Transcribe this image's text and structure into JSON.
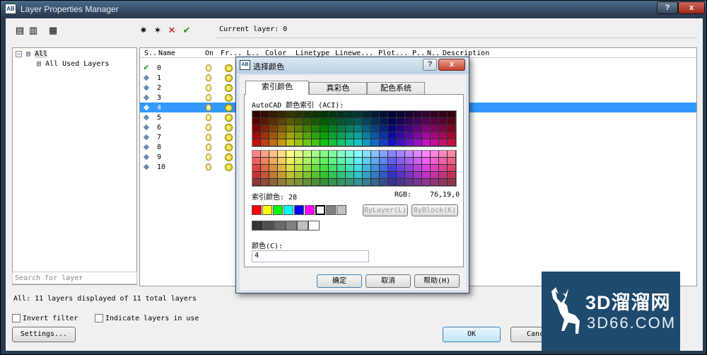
{
  "window": {
    "title": "Layer Properties Manager",
    "app_icon": "AB",
    "help": "?",
    "close": "x"
  },
  "toolbar": {
    "current_layer": "Current layer: 0"
  },
  "tree": {
    "root": "All",
    "child": "All Used Layers"
  },
  "search": {
    "placeholder": "Search for layer"
  },
  "grid": {
    "columns": [
      "S..",
      "Name",
      "On",
      "Fr...",
      "L..",
      "Color",
      "Linetype",
      "Linewe...",
      "Plot...",
      "P..",
      "N..",
      "Description"
    ],
    "rows": [
      {
        "name": "0",
        "current": true
      },
      {
        "name": "1"
      },
      {
        "name": "2"
      },
      {
        "name": "3"
      },
      {
        "name": "4",
        "selected": true
      },
      {
        "name": "5"
      },
      {
        "name": "6"
      },
      {
        "name": "7"
      },
      {
        "name": "8"
      },
      {
        "name": "9"
      },
      {
        "name": "10"
      }
    ]
  },
  "status": "All: 11 layers displayed of 11 total layers",
  "options": {
    "invert_filter": "Invert filter",
    "indicate_layers": "Indicate layers in use"
  },
  "buttons": {
    "settings": "Settings...",
    "ok": "OK",
    "cancel": "Cancel"
  },
  "dialog": {
    "icon": "AB",
    "title": "选择颜色",
    "help": "?",
    "close": "x",
    "tabs": [
      "索引颜色",
      "真彩色",
      "配色系统"
    ],
    "aci_label": "AutoCAD 颜色索引 (ACI):",
    "index_label": "索引颜色: 28",
    "rgb_label": "RGB:",
    "rgb_value": "76,19,0",
    "bylayer": "ByLayer(L)",
    "byblock": "ByBlock(K)",
    "color_label": "颜色(C):",
    "color_value": "4",
    "ok": "确定",
    "cancel": "取消",
    "help_btn": "帮助(H)",
    "standard_colors": [
      "#ff0000",
      "#ffff00",
      "#00ff00",
      "#00ffff",
      "#0000ff",
      "#ff00ff",
      "#ffffff",
      "#808080",
      "#c0c0c0"
    ],
    "gray_colors": [
      "#333333",
      "#505050",
      "#696969",
      "#808080",
      "#bebebe",
      "#ffffff"
    ]
  },
  "watermark": {
    "title": "3D溜溜网",
    "subtitle": "3D66.COM"
  }
}
